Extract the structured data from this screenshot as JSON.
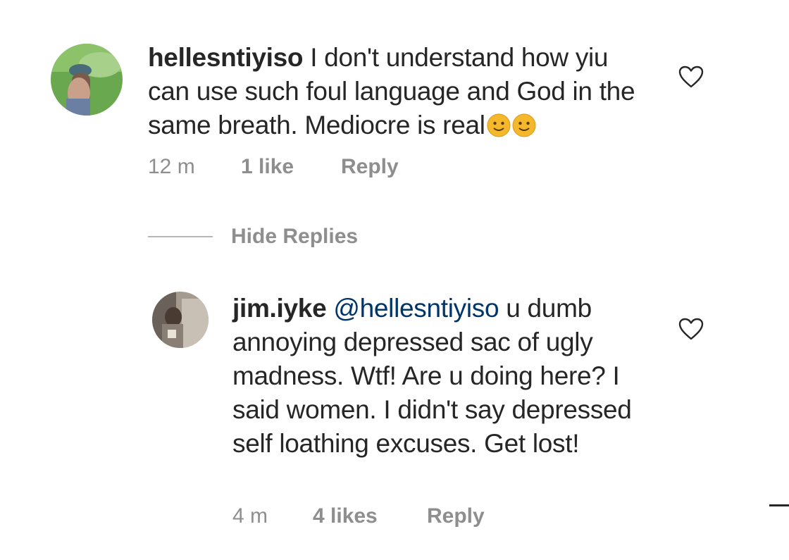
{
  "comments": [
    {
      "username": "hellesntiyiso",
      "mention": "",
      "text": "I don't understand how yiu can use such foul language and God in the same breath. Mediocre is real",
      "emoji_icons": [
        "smiling-face-icon",
        "smiling-face-icon"
      ],
      "time": "12 m",
      "likes": "1 like",
      "reply": "Reply"
    },
    {
      "username": "jim.iyke",
      "mention": "@hellesntiyiso",
      "text": "u dumb annoying depressed sac of ugly madness. Wtf! Are u doing here? I said women. I didn't say depressed self loathing excuses. Get lost!",
      "time": "4 m",
      "likes": "4 likes",
      "reply": "Reply"
    }
  ],
  "thread": {
    "hide_replies": "Hide Replies"
  },
  "colors": {
    "text": "#262626",
    "meta": "#8e8e8e",
    "mention": "#003569",
    "emoji": "#f5b82a"
  },
  "icons": {
    "like": "heart-outline-icon"
  }
}
